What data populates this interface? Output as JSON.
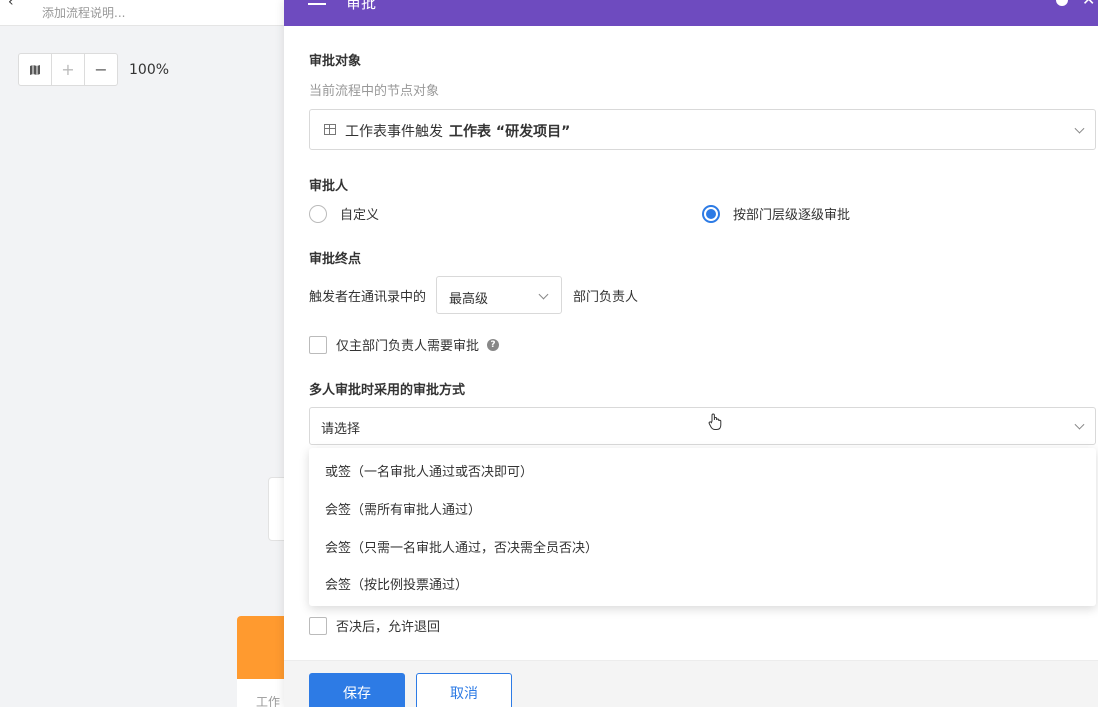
{
  "canvas": {
    "description_placeholder": "添加流程说明...",
    "zoom_level": "100%",
    "node_label": "工作"
  },
  "panel": {
    "title": "审批",
    "target": {
      "section_title": "审批对象",
      "hint": "当前流程中的节点对象",
      "select_prefix": "工作表事件触发",
      "select_value": "工作表 “研发项目”"
    },
    "approver": {
      "section_title": "审批人",
      "options": [
        {
          "label": "自定义",
          "checked": false
        },
        {
          "label": "按部门层级逐级审批",
          "checked": true
        }
      ]
    },
    "endpoint": {
      "section_title": "审批终点",
      "prefix": "触发者在通讯录中的",
      "level_value": "最高级",
      "suffix": "部门负责人"
    },
    "only_main_dept": {
      "label": "仅主部门负责人需要审批",
      "checked": false
    },
    "method": {
      "section_title": "多人审批时采用的审批方式",
      "placeholder": "请选择",
      "options": [
        "或签（一名审批人通过或否决即可）",
        "会签（需所有审批人通过）",
        "会签（只需一名审批人通过，否决需全员否决）",
        "会签（按比例投票通过）"
      ]
    },
    "partially_hidden_option": "否决后，允许退回",
    "footer": {
      "save_label": "保存",
      "cancel_label": "取消"
    }
  },
  "colors": {
    "header_purple": "#6e4bbf",
    "primary_blue": "#2d7be5",
    "node_orange": "#ff9a2f"
  }
}
